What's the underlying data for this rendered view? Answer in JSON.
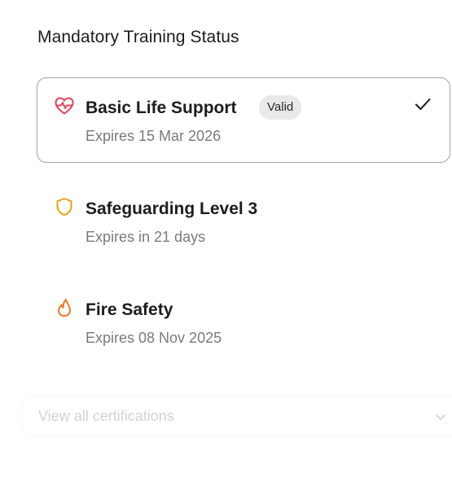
{
  "panel": {
    "title": "Mandatory Training Status"
  },
  "certifications": [
    {
      "name": "Basic Life Support",
      "badge": "Valid",
      "expiry": "Expires 15 Mar 2026",
      "icon": "heart-pulse-icon",
      "icon_color": "#e0455e",
      "selected": true
    },
    {
      "name": "Safeguarding Level 3",
      "expiry": "Expires in 21 days",
      "icon": "shield-icon",
      "icon_color": "#e8a317",
      "selected": false
    },
    {
      "name": "Fire Safety",
      "expiry": "Expires 08 Nov 2025",
      "icon": "flame-icon",
      "icon_color": "#ee7a2a",
      "selected": false
    }
  ],
  "footer": {
    "view_all_label": "View all certifications"
  }
}
